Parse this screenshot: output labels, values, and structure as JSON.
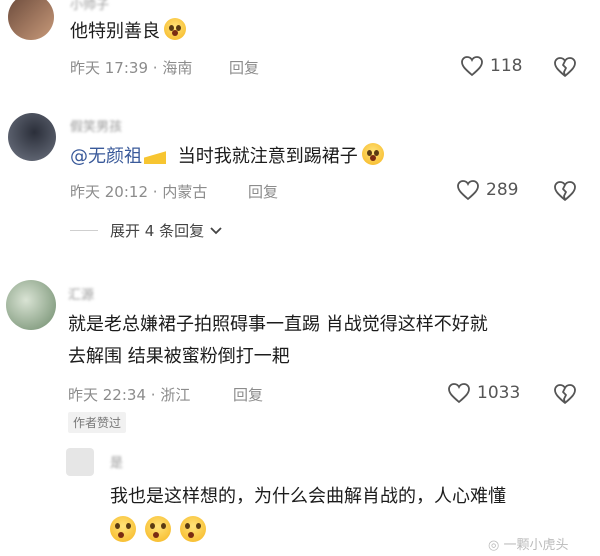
{
  "comments": [
    {
      "text": "他特别善良",
      "time": "昨天 17:39",
      "location": "海南",
      "reply_label": "回复",
      "likes": "118"
    },
    {
      "mention": "@无颜祖",
      "text": "当时我就注意到踢裙子",
      "time": "昨天 20:12",
      "location": "内蒙古",
      "reply_label": "回复",
      "likes": "289",
      "expand_label": "展开 4 条回复"
    },
    {
      "text_line1": "就是老总嫌裙子拍照碍事一直踢 肖战觉得这样不好就",
      "text_line2": "去解围 结果被蜜粉倒打一耙",
      "time": "昨天 22:34",
      "location": "浙江",
      "reply_label": "回复",
      "likes": "1033",
      "author_tag": "作者赞过"
    },
    {
      "text": "我也是这样想的，为什么会曲解肖战的，人心难懂"
    }
  ],
  "watermark": "一颗小虎头",
  "icons": {
    "like": "heart-outline-icon",
    "dislike": "broken-heart-icon",
    "emoji": "crying-face-emoji",
    "cheese": "cheese-icon"
  }
}
